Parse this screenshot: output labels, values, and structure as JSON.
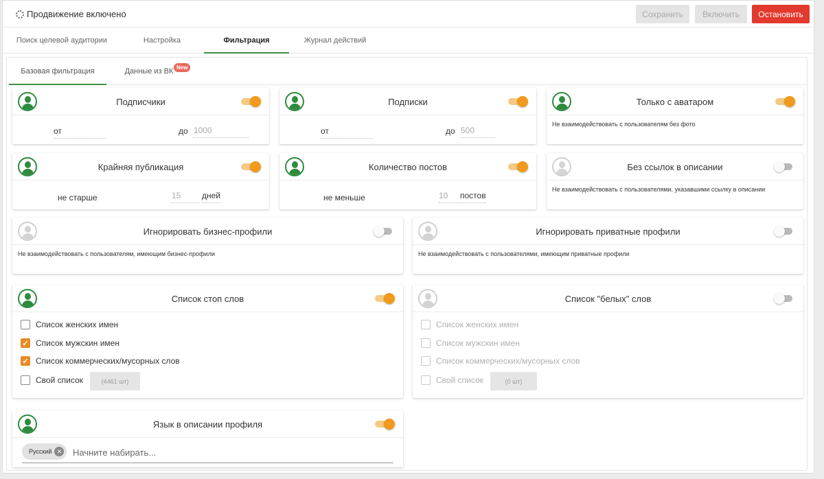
{
  "topbar": {
    "status": "Продвижение включено",
    "save": "Сохранить",
    "enable": "Включить",
    "stop": "Остановить"
  },
  "tabs": [
    "Поиск целевой аудитории",
    "Настройка",
    "Фильтрация",
    "Журнал действий"
  ],
  "active_tab": "Фильтрация",
  "subtabs": [
    "Базовая фильтрация",
    "Данные из ВК"
  ],
  "active_subtab": "Базовая фильтрация",
  "new_badge": "New",
  "colors": {
    "accent_green": "#3f8f47",
    "toggle_orange": "#f29a1b",
    "stop_red": "#e23a2e",
    "checkbox_orange": "#e98a26"
  },
  "cards": {
    "followers": {
      "title": "Подписчики",
      "enabled": true,
      "from_label": "от",
      "from_value": "",
      "to_label": "до",
      "to_placeholder": "1000"
    },
    "following": {
      "title": "Подписки",
      "enabled": true,
      "from_label": "от",
      "from_value": "",
      "to_label": "до",
      "to_placeholder": "500"
    },
    "avatar": {
      "title": "Только с аватаром",
      "enabled": true,
      "desc": "Не взаимодействовать с пользователям без фото"
    },
    "last_post": {
      "title": "Крайняя публикация",
      "enabled": true,
      "prefix": "не старше",
      "value": "15",
      "suffix": "дней"
    },
    "posts_count": {
      "title": "Количество постов",
      "enabled": true,
      "prefix": "не меньше",
      "value": "10",
      "suffix": "постов"
    },
    "no_links": {
      "title": "Без ссылок в описании",
      "enabled": false,
      "desc": "Не взаимодействовать с пользователями, указавшими ссылку в описании"
    },
    "business": {
      "title": "Игнорировать бизнес-профили",
      "enabled": false,
      "desc": "Не взаимодействовать с пользователям, имеющим бизнес-профили"
    },
    "private": {
      "title": "Игнорировать приватные профили",
      "enabled": false,
      "desc": "Не взаимодействовать с пользователями, имеющим приватные профили"
    },
    "stopwords": {
      "title": "Список стоп слов",
      "enabled": true,
      "items": [
        {
          "label": "Список женских имен",
          "checked": false
        },
        {
          "label": "Список мужскин имен",
          "checked": true
        },
        {
          "label": "Список коммерческих/мусорных слов",
          "checked": true
        },
        {
          "label": "Свой список",
          "checked": false
        }
      ],
      "count": "(4461 шт)"
    },
    "whitewords": {
      "title": "Список \"белых\" слов",
      "enabled": false,
      "items": [
        {
          "label": "Список женских имен",
          "checked": false
        },
        {
          "label": "Список мужскин имен",
          "checked": false
        },
        {
          "label": "Список коммерческих/мусорных слов",
          "checked": false
        },
        {
          "label": "Свой список",
          "checked": false
        }
      ],
      "count": "(0 шт)"
    },
    "language": {
      "title": "Язык в описании профиля",
      "enabled": true,
      "chip": "Русский",
      "placeholder": "Начните набирать..."
    }
  }
}
